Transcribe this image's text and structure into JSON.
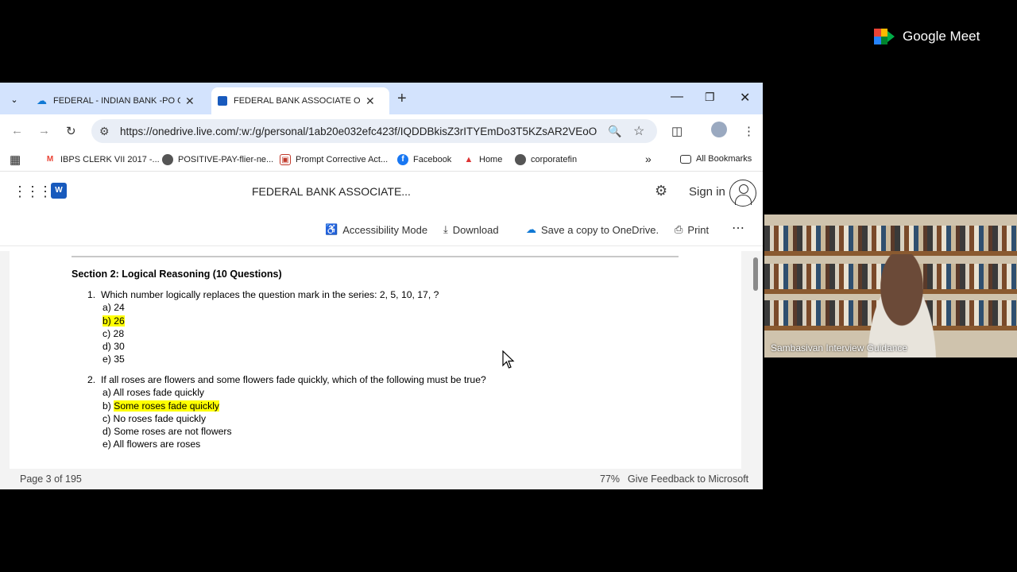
{
  "browser": {
    "tabs": [
      {
        "label": "FEDERAL - INDIAN BANK -PO CLE",
        "icon": "onedrive-icon",
        "active": false
      },
      {
        "label": "FEDERAL BANK ASSOCIATE OFFICE",
        "icon": "word-icon",
        "active": true
      }
    ],
    "url": "https://onedrive.live.com/:w:/g/personal/1ab20e032efc423f/IQDDBkisZ3rITYEmDo3T5KZsAR2VEoO...",
    "bookmarks": [
      {
        "label": "IBPS CLERK VII 2017 -...",
        "icon": "gmail-icon"
      },
      {
        "label": "POSITIVE-PAY-flier-ne...",
        "icon": "globe-icon"
      },
      {
        "label": "Prompt Corrective Act...",
        "icon": "bookmark-icon"
      },
      {
        "label": "Facebook",
        "icon": "facebook-icon"
      },
      {
        "label": "Home",
        "icon": "home-icon"
      },
      {
        "label": "corporatefin",
        "icon": "globe-icon"
      }
    ],
    "all_bookmarks": "All Bookmarks"
  },
  "app": {
    "doc_title": "FEDERAL BANK ASSOCIATE...",
    "sign_in": "Sign in",
    "commands": {
      "accessibility": "Accessibility Mode",
      "download": "Download",
      "save_copy": "Save a copy to OneDrive.",
      "print": "Print"
    }
  },
  "document": {
    "section_title": "Section 2: Logical Reasoning (10 Questions)",
    "questions": [
      {
        "number": "1.",
        "text": "Which number logically replaces the question mark in the series: 2, 5, 10, 17, ?",
        "options": [
          "a) 24",
          "b) 26",
          "c) 28",
          "d) 30",
          "e) 35"
        ],
        "highlighted": 1
      },
      {
        "number": "2.",
        "text": "If all roses are flowers and some flowers fade quickly, which of the following must be true?",
        "options": [
          "a) All roses fade quickly",
          "b) Some roses fade quickly",
          "c) No roses fade quickly",
          "d) Some roses are not flowers",
          "e) All flowers are roses"
        ],
        "highlighted": 1
      }
    ]
  },
  "status": {
    "page": "Page 3 of 195",
    "zoom": "77%",
    "feedback": "Give Feedback to Microsoft"
  },
  "meet": {
    "brand": "Google Meet",
    "participant": "Sambasivan Interview Guidance"
  },
  "colors": {
    "tabbar": "#d3e3fd",
    "highlight": "#ffff00",
    "word_blue": "#185abd"
  }
}
